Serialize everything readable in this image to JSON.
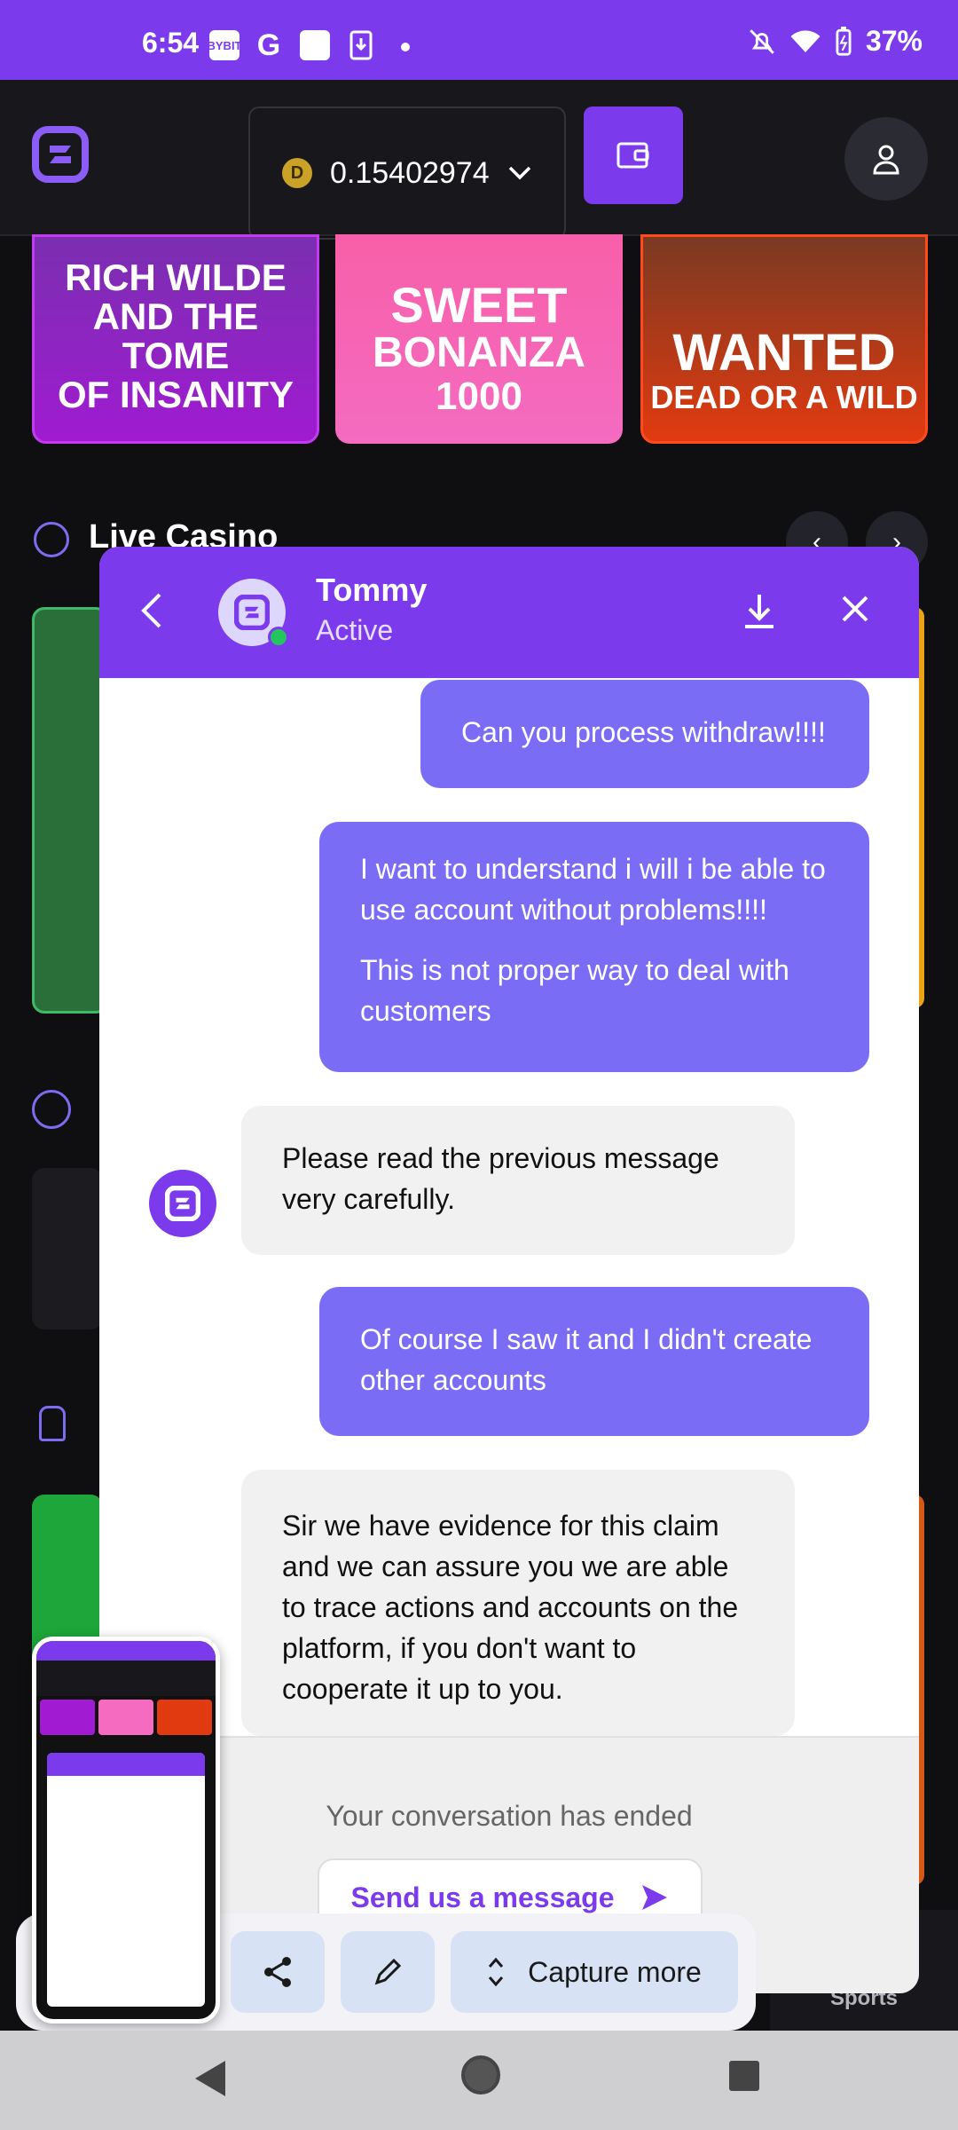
{
  "status": {
    "time": "6:54",
    "icons": [
      "bybit-icon",
      "google-icon",
      "square-icon",
      "download-icon"
    ],
    "bybit": "BYBIT",
    "google": "G",
    "battery": "37%"
  },
  "header": {
    "balance": "0.15402974",
    "coin_letter": "D"
  },
  "tiles": [
    {
      "lines": [
        "RICH WILDE",
        "AND THE TOME",
        "OF INSANITY"
      ]
    },
    {
      "lines": [
        "SWEET",
        "BONANZA",
        "1000"
      ]
    },
    {
      "lines": [
        "WANTED",
        "DEAD OR A WILD"
      ]
    }
  ],
  "section": {
    "title": "Live Casino"
  },
  "chat": {
    "agent_name": "Tommy",
    "agent_status": "Active",
    "messages": [
      {
        "from": "user",
        "paragraphs": [
          "Can you process withdraw!!!!"
        ]
      },
      {
        "from": "user",
        "paragraphs": [
          "I want to understand i will i be able to use account without problems!!!!",
          "This is not proper way to deal with customers"
        ]
      },
      {
        "from": "agent",
        "paragraphs": [
          "Please read the previous message very carefully."
        ]
      },
      {
        "from": "user",
        "paragraphs": [
          "Of course I saw it and I didn't create other accounts"
        ]
      },
      {
        "from": "agent",
        "paragraphs": [
          "Sir we have evidence for this claim and we can assure you we are able to trace actions and accounts on the platform, if you don't want to cooperate it up to you."
        ]
      }
    ],
    "ended_text": "Your conversation has ended",
    "send_label": "Send us a message"
  },
  "bottom_tab": {
    "label": "Sports"
  },
  "screenshot_tools": {
    "capture_more": "Capture more"
  },
  "colors": {
    "brand": "#7c3aed",
    "user_bubble": "#7b6cf6",
    "agent_bubble": "#f1f1f2",
    "online": "#22c55e"
  }
}
